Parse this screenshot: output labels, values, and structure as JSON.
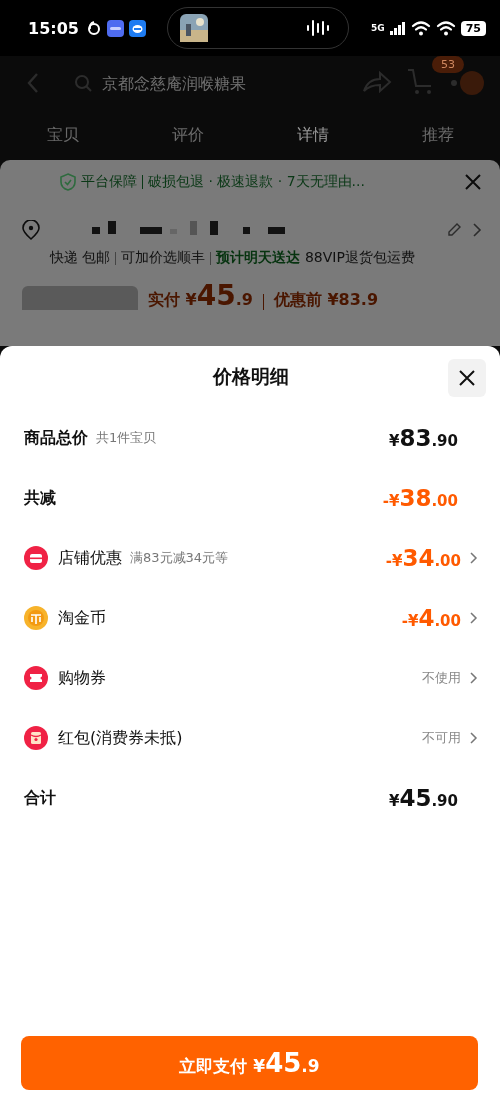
{
  "status_bar": {
    "time": "15:05",
    "network": "5G",
    "battery": "75"
  },
  "header": {
    "search_placeholder": "京都念慈庵润喉糖果",
    "cart_badge": "53"
  },
  "tabs": [
    {
      "label": "宝贝",
      "selected": false
    },
    {
      "label": "评价",
      "selected": false
    },
    {
      "label": "详情",
      "selected": true
    },
    {
      "label": "推荐",
      "selected": false
    }
  ],
  "order_sheet": {
    "guarantee": "平台保障",
    "guarantee_detail": "破损包退 · 极速退款 · 7天无理由...",
    "delivery": [
      "快递 包邮",
      "可加价选顺丰"
    ],
    "delivery_estimate": "预计明天送达",
    "vip_note": "88VIP退货包运费",
    "paid_label": "实付",
    "paid_price": {
      "prefix": "¥",
      "major": "45",
      "minor": ".9"
    },
    "before_label": "优惠前 ¥83.9"
  },
  "price_sheet": {
    "title": "价格明细",
    "rows": [
      {
        "kind": "total",
        "label": "商品总价",
        "note": "共1件宝贝",
        "amount": {
          "prefix": "¥",
          "major": "83",
          "minor": ".90"
        },
        "chevron": false
      },
      {
        "kind": "discount",
        "label": "共减",
        "amount": {
          "sign": "-",
          "prefix": "¥",
          "major": "38",
          "minor": ".00"
        },
        "chevron": false
      },
      {
        "kind": "shop",
        "label": "店铺优惠",
        "note": "满83元减34元等",
        "amount": {
          "sign": "-",
          "prefix": "¥",
          "major": "34",
          "minor": ".00"
        },
        "chevron": true
      },
      {
        "kind": "coin",
        "label": "淘金币",
        "amount": {
          "sign": "-",
          "prefix": "¥",
          "major": "4",
          "minor": ".00"
        },
        "chevron": true
      },
      {
        "kind": "coupon",
        "label": "购物券",
        "status": "不使用",
        "chevron": true
      },
      {
        "kind": "packet",
        "label": "红包(消费券未抵)",
        "status": "不可用",
        "chevron": true
      },
      {
        "kind": "total",
        "label": "合计",
        "amount": {
          "prefix": "¥",
          "major": "45",
          "minor": ".90"
        },
        "chevron": false
      }
    ],
    "pay_button": {
      "label": "立即支付",
      "prefix": "¥",
      "major": "45",
      "minor": ".9"
    }
  }
}
